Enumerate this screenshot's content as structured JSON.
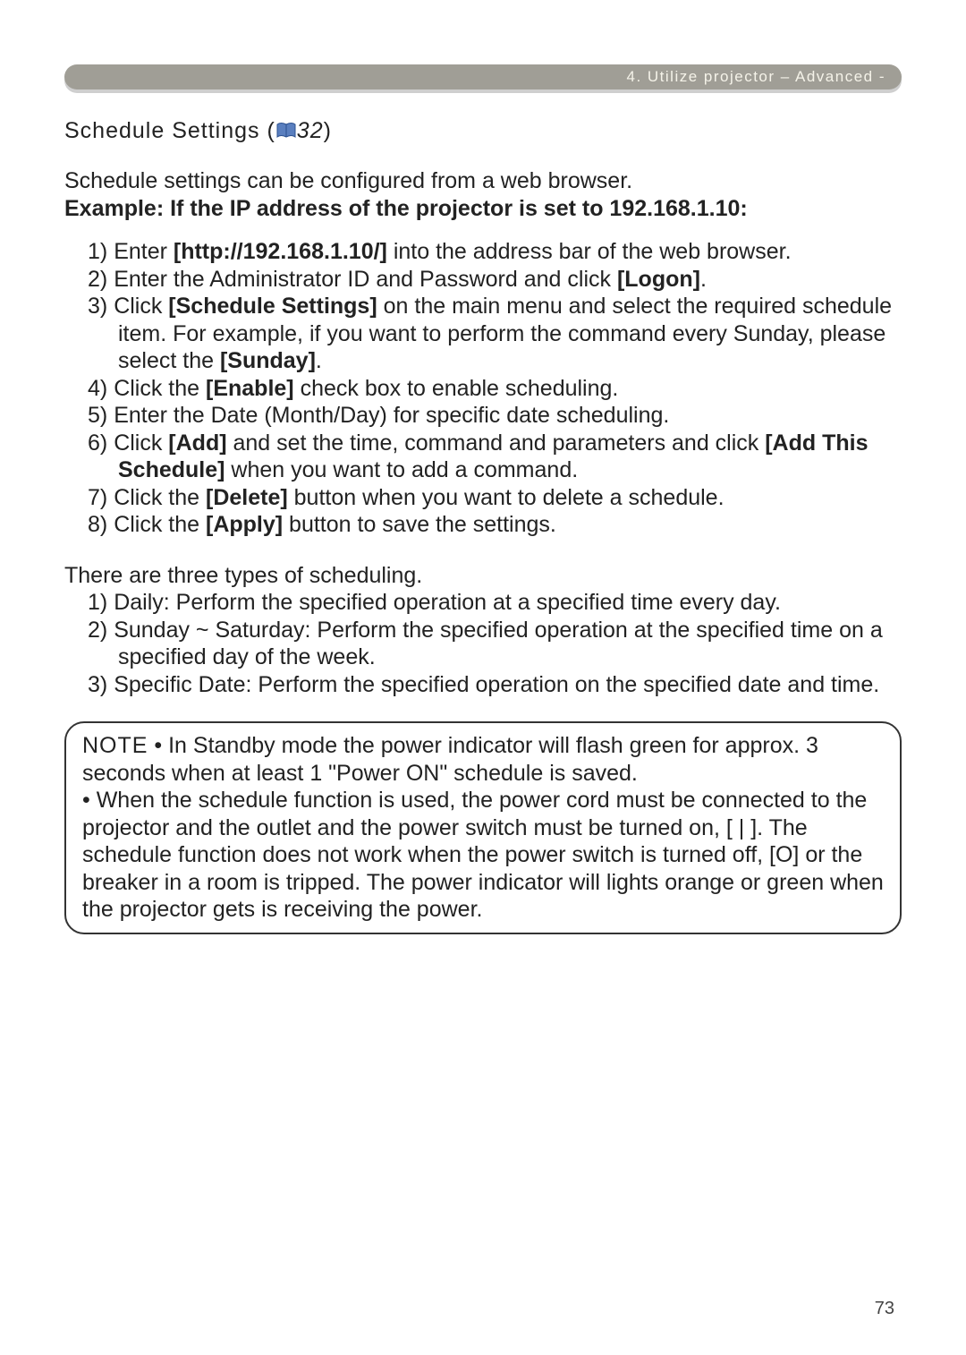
{
  "header": {
    "breadcrumb": "4. Utilize projector – Advanced -"
  },
  "section": {
    "title_prefix": "Schedule Settings (",
    "page_ref": "32",
    "title_suffix": ")"
  },
  "intro": {
    "line1": "Schedule settings can be configured from a web browser.",
    "example_label": "Example: If the IP address of the projector is set to 192.168.1.10:"
  },
  "steps": [
    {
      "pre": "Enter ",
      "b1": "[http://192.168.1.10/]",
      "post": " into the address bar of the web browser."
    },
    {
      "pre": "Enter the Administrator ID and Password and click ",
      "b1": "[Logon]",
      "post": "."
    },
    {
      "pre": "Click ",
      "b1": "[Schedule Settings]",
      "mid": " on the main menu and select the required schedule item. For example, if you want to perform the command every Sunday, please select the ",
      "b2": "[Sunday]",
      "post": "."
    },
    {
      "pre": "Click the ",
      "b1": "[Enable]",
      "post": " check box to enable scheduling."
    },
    {
      "pre": "Enter the Date (Month/Day) for specific date scheduling.",
      "b1": "",
      "post": ""
    },
    {
      "pre": "Click ",
      "b1": "[Add]",
      "mid": " and set the time, command and parameters and click ",
      "b2": "[Add This Schedule]",
      "post": " when you want to add a command."
    },
    {
      "pre": "Click the ",
      "b1": "[Delete]",
      "post": " button when you want to delete a schedule."
    },
    {
      "pre": "Click the ",
      "b1": "[Apply]",
      "post": " button to save the settings."
    }
  ],
  "types_intro": "There are three types of scheduling.",
  "types": [
    "Daily: Perform the specified operation at a specified time every day.",
    "Sunday ~ Saturday: Perform the specified operation at the specified time on a specified day of the week.",
    "Specific Date: Perform the specified operation on the specified date and time."
  ],
  "note": {
    "label": "NOTE",
    "bullet1": "• In Standby mode the power indicator will flash green for approx. 3 seconds when at least 1 \"Power ON\" schedule is saved.",
    "bullet2": "• When the schedule function is used, the power cord must be connected to the projector and the outlet and the power switch must be turned on, [ | ]. The schedule function does not work when the power switch is turned off, [O] or the breaker in a room is tripped. The power indicator will lights orange or green when the projector gets is receiving the power."
  },
  "page_number": "73"
}
